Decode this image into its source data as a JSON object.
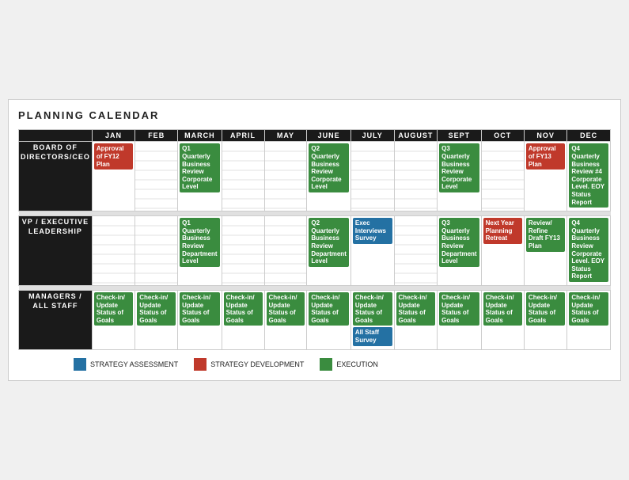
{
  "title": "PLANNING CALENDAR",
  "months": [
    "JAN",
    "FEB",
    "MARCH",
    "APRIL",
    "MAY",
    "JUNE",
    "JULY",
    "AUGUST",
    "SEPT",
    "OCT",
    "NOV",
    "DEC"
  ],
  "rows": [
    {
      "label": "BOARD OF\nDIRECTORS/CEO",
      "cells": [
        {
          "month": "JAN",
          "events": [
            {
              "color": "red",
              "text": "Approval of FY12 Plan"
            }
          ]
        },
        {
          "month": "FEB",
          "events": []
        },
        {
          "month": "MARCH",
          "events": [
            {
              "color": "green",
              "text": "Q1 Quarterly Business Review Corporate Level"
            }
          ]
        },
        {
          "month": "APRIL",
          "events": []
        },
        {
          "month": "MAY",
          "events": []
        },
        {
          "month": "JUNE",
          "events": [
            {
              "color": "green",
              "text": "Q2 Quarterly Business Review Corporate Level"
            }
          ]
        },
        {
          "month": "JULY",
          "events": []
        },
        {
          "month": "AUGUST",
          "events": []
        },
        {
          "month": "SEPT",
          "events": [
            {
              "color": "green",
              "text": "Q3 Quarterly Business Review Corporate Level"
            }
          ]
        },
        {
          "month": "OCT",
          "events": []
        },
        {
          "month": "NOV",
          "events": [
            {
              "color": "red",
              "text": "Approval of FY13 Plan"
            }
          ]
        },
        {
          "month": "DEC",
          "events": [
            {
              "color": "green",
              "text": "Q4 Quarterly Business Review #4 Corporate Level. EOY Status Report"
            }
          ]
        }
      ]
    },
    {
      "label": "VP / EXECUTIVE\nLEADERSHIP",
      "cells": [
        {
          "month": "JAN",
          "events": []
        },
        {
          "month": "FEB",
          "events": []
        },
        {
          "month": "MARCH",
          "events": [
            {
              "color": "green",
              "text": "Q1 Quarterly Business Review Department Level"
            }
          ]
        },
        {
          "month": "APRIL",
          "events": []
        },
        {
          "month": "MAY",
          "events": []
        },
        {
          "month": "JUNE",
          "events": [
            {
              "color": "green",
              "text": "Q2 Quarterly Business Review Department Level"
            }
          ]
        },
        {
          "month": "JULY",
          "events": [
            {
              "color": "blue",
              "text": "Exec Interviews Survey"
            }
          ]
        },
        {
          "month": "AUGUST",
          "events": []
        },
        {
          "month": "SEPT",
          "events": [
            {
              "color": "green",
              "text": "Q3 Quarterly Business Review Department Level"
            }
          ]
        },
        {
          "month": "OCT",
          "events": [
            {
              "color": "red",
              "text": "Next Year Planning Retreat"
            }
          ]
        },
        {
          "month": "NOV",
          "events": [
            {
              "color": "green",
              "text": "Review/ Refine Draft FY13 Plan"
            }
          ]
        },
        {
          "month": "DEC",
          "events": [
            {
              "color": "green",
              "text": "Q4 Quarterly Business Review Corporate Level. EOY Status Report"
            }
          ]
        }
      ]
    },
    {
      "label": "MANAGERS /\nALL STAFF",
      "cells": [
        {
          "month": "JAN",
          "events": [
            {
              "color": "green",
              "text": "Check-in/ Update Status of Goals"
            }
          ]
        },
        {
          "month": "FEB",
          "events": [
            {
              "color": "green",
              "text": "Check-in/ Update Status of Goals"
            }
          ]
        },
        {
          "month": "MARCH",
          "events": [
            {
              "color": "green",
              "text": "Check-in/ Update Status of Goals"
            }
          ]
        },
        {
          "month": "APRIL",
          "events": [
            {
              "color": "green",
              "text": "Check-in/ Update Status of Goals"
            }
          ]
        },
        {
          "month": "MAY",
          "events": [
            {
              "color": "green",
              "text": "Check-in/ Update Status of Goals"
            }
          ]
        },
        {
          "month": "JUNE",
          "events": [
            {
              "color": "green",
              "text": "Check-in/ Update Status of Goals"
            }
          ]
        },
        {
          "month": "JULY",
          "events": [
            {
              "color": "green",
              "text": "Check-in/ Update Status of Goals"
            },
            {
              "color": "blue",
              "text": "All Staff Survey"
            }
          ]
        },
        {
          "month": "AUGUST",
          "events": [
            {
              "color": "green",
              "text": "Check-in/ Update Status of Goals"
            }
          ]
        },
        {
          "month": "SEPT",
          "events": [
            {
              "color": "green",
              "text": "Check-in/ Update Status of Goals"
            }
          ]
        },
        {
          "month": "OCT",
          "events": [
            {
              "color": "green",
              "text": "Check-in/ Update Status of Goals"
            }
          ]
        },
        {
          "month": "NOV",
          "events": [
            {
              "color": "green",
              "text": "Check-in/ Update Status of Goals"
            }
          ]
        },
        {
          "month": "DEC",
          "events": [
            {
              "color": "green",
              "text": "Check-in/ Update Status of Goals"
            }
          ]
        }
      ]
    }
  ],
  "legend": [
    {
      "color": "blue",
      "label": "STRATEGY ASSESSMENT"
    },
    {
      "color": "red",
      "label": "STRATEGY DEVELOPMENT"
    },
    {
      "color": "green",
      "label": "EXECUTION"
    }
  ]
}
